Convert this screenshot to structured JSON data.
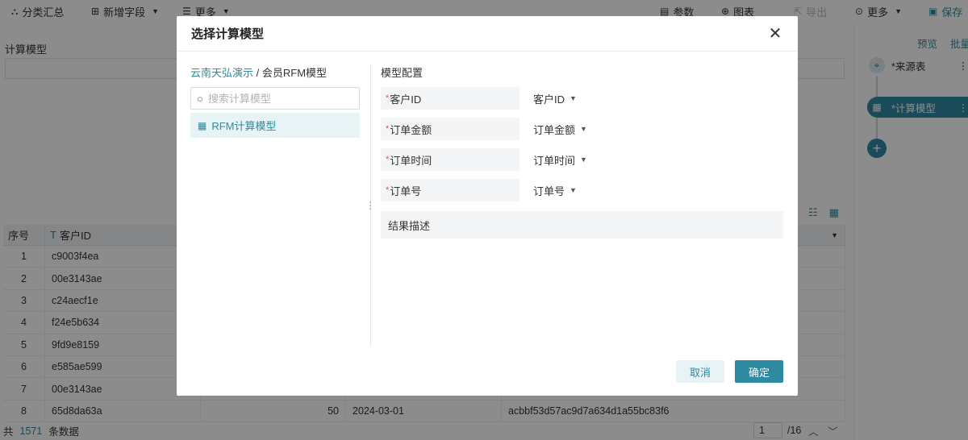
{
  "toolbar": {
    "group_summary": "分类汇总",
    "add_field": "新增字段",
    "more_left": "更多",
    "params": "参数",
    "chart": "图表",
    "export": "导出",
    "more_right": "更多",
    "save": "保存"
  },
  "workspace": {
    "model_label": "计算模型"
  },
  "grid": {
    "headers": [
      "序号",
      "客户ID"
    ],
    "rows": [
      {
        "idx": "1",
        "id": "c9003f4ea"
      },
      {
        "idx": "2",
        "id": "00e3143ae"
      },
      {
        "idx": "3",
        "id": "c24aecf1e"
      },
      {
        "idx": "4",
        "id": "f24e5b634"
      },
      {
        "idx": "5",
        "id": "9fd9e8159"
      },
      {
        "idx": "6",
        "id": "e585ae599"
      },
      {
        "idx": "7",
        "id": "00e3143ae"
      },
      {
        "idx": "8",
        "id": "65d8da63a",
        "amount": "50",
        "time": "2024-03-01",
        "order_no": "acbbf53d57ac9d7a634d1a55bc83f6"
      }
    ]
  },
  "footer": {
    "prefix": "共",
    "count": "1571",
    "suffix": "条数据",
    "page": "1",
    "total_pages": "/16"
  },
  "right_panel": {
    "preview": "预览",
    "batch": "批量",
    "source_node": "*来源表",
    "calc_node": "*计算模型",
    "add": "+"
  },
  "modal": {
    "title": "选择计算模型",
    "breadcrumb_link": "云南天弘演示",
    "breadcrumb_sep": " / ",
    "breadcrumb_current": "会员RFM模型",
    "search_placeholder": "搜索计算模型",
    "model_item": "RFM计算模型",
    "section_title": "模型配置",
    "config": [
      {
        "label": "客户ID",
        "value": "客户ID"
      },
      {
        "label": "订单金额",
        "value": "订单金额"
      },
      {
        "label": "订单时间",
        "value": "订单时间"
      },
      {
        "label": "订单号",
        "value": "订单号"
      }
    ],
    "required_mark": "*",
    "result_label": "结果描述",
    "cancel": "取消",
    "ok": "确定"
  }
}
